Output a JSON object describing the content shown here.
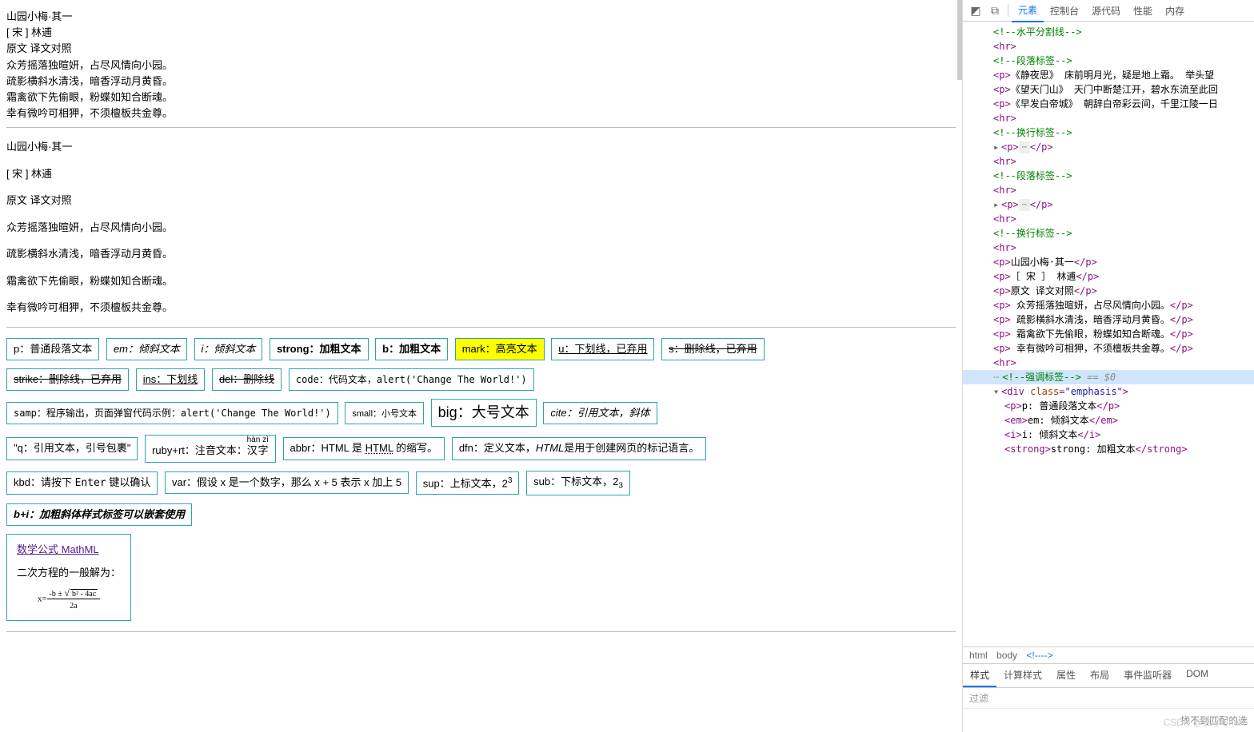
{
  "poem1": {
    "title": "山园小梅·其一",
    "author": "[ 宋 ] 林逋",
    "subtitle": "原文 译文对照",
    "lines": [
      "众芳摇落独暄妍，占尽风情向小园。",
      "疏影横斜水清浅，暗香浮动月黄昏。",
      "霜禽欲下先偷眼，粉蝶如知合断魂。",
      "幸有微吟可相狎，不须檀板共金尊。"
    ]
  },
  "poem2": {
    "title": "山园小梅·其一",
    "author": "[ 宋 ] 林逋",
    "subtitle": "原文 译文对照",
    "lines": [
      "众芳摇落独暄妍，占尽风情向小园。",
      "疏影横斜水清浅，暗香浮动月黄昏。",
      "霜禽欲下先偷眼，粉蝶如知合断魂。",
      "幸有微吟可相狎，不须檀板共金尊。"
    ]
  },
  "tags": {
    "p": "p：普通段落文本",
    "em": "em：倾斜文本",
    "i": "i：倾斜文本",
    "strong": "strong：加粗文本",
    "b": "b：加粗文本",
    "mark": "mark：高亮文本",
    "u": "u：下划线，已弃用",
    "s": "s：删除线，已弃用",
    "strike": "strike：删除线，已弃用",
    "ins": "ins：下划线",
    "del": "del：删除线",
    "code": "code：代码文本，alert('Change The World!')",
    "samp": "samp：程序输出，页面弹窗代码示例：alert('Change The World!')",
    "small": "small：小号文本",
    "big": "big：大号文本",
    "cite": "cite：引用文本，斜体",
    "q": "\"q：引用文本，引号包裹\"",
    "ruby_pre": "ruby+rt：注音文本：",
    "ruby_base": "汉字",
    "ruby_rt": "hàn zì",
    "abbr_pre": "abbr：HTML 是 ",
    "abbr_word": "HTML",
    "abbr_post": " 的缩写。",
    "dfn_pre": "dfn：定义文本，",
    "dfn_word": "HTML",
    "dfn_post": "是用于创建网页的标记语言。",
    "kbd_pre": "kbd：请按下 ",
    "kbd_key": "Enter",
    "kbd_post": " 键以确认",
    "var": "var：假设 x 是一个数字，那么 x + 5 表示 x 加上 5",
    "sup_pre": "sup：上标文本，2",
    "sup_val": "3",
    "sub_pre": "sub：下标文本，2",
    "sub_val": "3",
    "bi": "b+i：加粗斜体样式标签可以嵌套使用",
    "mathml_link": "数学公式 MathML",
    "math_desc": "二次方程的一般解为：",
    "math_formula": {
      "x": "x=",
      "num_pre": "-b ± ",
      "sqrt": "b² - 4ac",
      "den": "2a"
    }
  },
  "devtools": {
    "tabs": [
      "元素",
      "控制台",
      "源代码",
      "性能",
      "内存"
    ],
    "active_tab": "元素",
    "dom": {
      "c_hr": "<!--水平分割线-->",
      "c_para": "<!--段落标签-->",
      "c_br": "<!--换行标签-->",
      "c_emph": "<!--强调标签-->",
      "eq0": " == $0",
      "p1": "《静夜思》 床前明月光，疑是地上霜。 举头望",
      "p2": "《望天门山》 天门中断楚江开，碧水东流至此回",
      "p3": "《早发白帝城》 朝辞白帝彩云间，千里江陵一日",
      "hr": "<hr>",
      "pdots_open": "<p>",
      "pdots_close": "</p>",
      "poem_title": "山园小梅·其一",
      "poem_author": "［ 宋 ］ 林逋",
      "poem_subtitle": "原文 译文对照",
      "poem_l1": " 众芳摇落独暄妍，占尽风情向小园。",
      "poem_l2": " 疏影横斜水清浅，暗香浮动月黄昏。",
      "poem_l3": " 霜禽欲下先偷眼，粉蝶如知合断魂。",
      "poem_l4": " 幸有微吟可相狎，不须檀板共金尊。",
      "div_open_tag": "div",
      "div_attr": "class",
      "div_val": "\"emphasis\"",
      "emp_p": "p: 普通段落文本",
      "emp_em": "em: 倾斜文本",
      "emp_i": "i: 倾斜文本",
      "emp_strong": "strong: 加粗文本"
    },
    "breadcrumb": [
      "html",
      "body",
      "<!---->"
    ],
    "styles_tabs": [
      "样式",
      "计算样式",
      "属性",
      "布局",
      "事件监听器",
      "DOM"
    ],
    "styles_active": "样式",
    "filter_placeholder": "过滤",
    "nomatch": "找不到匹配的选",
    "watermark": "CSDN @玄子Share"
  }
}
